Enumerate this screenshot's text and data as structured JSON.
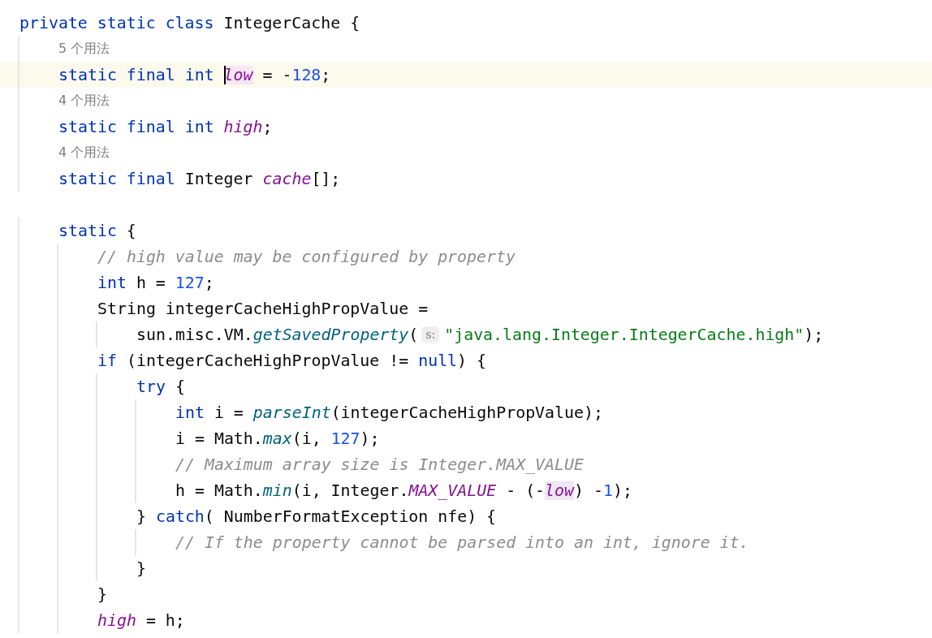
{
  "editor": {
    "lines": [
      {
        "kind": "code",
        "tokens": [
          {
            "kind": "keyword",
            "text": "private static class"
          },
          {
            "kind": "plain",
            "text": " IntegerCache {"
          }
        ],
        "children": [
          {
            "kind": "usages",
            "text": "5 个用法"
          },
          {
            "kind": "code",
            "current": true,
            "tokens": [
              {
                "kind": "keyword",
                "text": "static final int "
              },
              {
                "kind": "field",
                "text": "low",
                "caret": true,
                "color": "#f7e6f3"
              },
              {
                "kind": "plain",
                "text": " = -"
              },
              {
                "kind": "number",
                "text": "128"
              },
              {
                "kind": "plain",
                "text": ";"
              }
            ]
          },
          {
            "kind": "usages",
            "text": "4 个用法"
          },
          {
            "kind": "code",
            "tokens": [
              {
                "kind": "keyword",
                "text": "static final int "
              },
              {
                "kind": "field",
                "text": "high"
              },
              {
                "kind": "plain",
                "text": ";"
              }
            ]
          },
          {
            "kind": "usages",
            "text": "4 个用法"
          },
          {
            "kind": "code",
            "tokens": [
              {
                "kind": "keyword",
                "text": "static final"
              },
              {
                "kind": "plain",
                "text": " Integer "
              },
              {
                "kind": "field",
                "text": "cache"
              },
              {
                "kind": "plain",
                "text": "[];"
              }
            ]
          },
          {
            "kind": "blank"
          },
          {
            "kind": "code",
            "tokens": [
              {
                "kind": "keyword",
                "text": "static"
              },
              {
                "kind": "plain",
                "text": " {"
              }
            ],
            "children": [
              {
                "kind": "code",
                "tokens": [
                  {
                    "kind": "comment",
                    "text": "// high value may be configured by property"
                  }
                ]
              },
              {
                "kind": "code",
                "tokens": [
                  {
                    "kind": "keyword",
                    "text": "int"
                  },
                  {
                    "kind": "plain",
                    "text": " h = "
                  },
                  {
                    "kind": "number",
                    "text": "127"
                  },
                  {
                    "kind": "plain",
                    "text": ";"
                  }
                ]
              },
              {
                "kind": "code",
                "tokens": [
                  {
                    "kind": "plain",
                    "text": "String integerCacheHighPropValue ="
                  }
                ],
                "children": [
                  {
                    "kind": "code",
                    "tokens": [
                      {
                        "kind": "plain",
                        "text": "sun.misc.VM."
                      },
                      {
                        "kind": "method",
                        "text": "getSavedProperty"
                      },
                      {
                        "kind": "plain",
                        "text": "("
                      },
                      {
                        "kind": "hint",
                        "text": "s:"
                      },
                      {
                        "kind": "string",
                        "text": "\"java.lang.Integer.IntegerCache.high\""
                      },
                      {
                        "kind": "plain",
                        "text": ");"
                      }
                    ]
                  }
                ]
              },
              {
                "kind": "code",
                "tokens": [
                  {
                    "kind": "keyword",
                    "text": "if"
                  },
                  {
                    "kind": "plain",
                    "text": " (integerCacheHighPropValue != "
                  },
                  {
                    "kind": "keyword",
                    "text": "null"
                  },
                  {
                    "kind": "plain",
                    "text": ") {"
                  }
                ],
                "children": [
                  {
                    "kind": "code",
                    "tokens": [
                      {
                        "kind": "keyword",
                        "text": "try"
                      },
                      {
                        "kind": "plain",
                        "text": " {"
                      }
                    ],
                    "children": [
                      {
                        "kind": "code",
                        "tokens": [
                          {
                            "kind": "keyword",
                            "text": "int"
                          },
                          {
                            "kind": "plain",
                            "text": " i = "
                          },
                          {
                            "kind": "method",
                            "text": "parseInt"
                          },
                          {
                            "kind": "plain",
                            "text": "(integerCacheHighPropValue);"
                          }
                        ]
                      },
                      {
                        "kind": "code",
                        "tokens": [
                          {
                            "kind": "plain",
                            "text": "i = Math."
                          },
                          {
                            "kind": "method",
                            "text": "max"
                          },
                          {
                            "kind": "plain",
                            "text": "(i, "
                          },
                          {
                            "kind": "number",
                            "text": "127"
                          },
                          {
                            "kind": "plain",
                            "text": ");"
                          }
                        ]
                      },
                      {
                        "kind": "code",
                        "tokens": [
                          {
                            "kind": "comment",
                            "text": "// Maximum array size is Integer.MAX_VALUE"
                          }
                        ]
                      },
                      {
                        "kind": "code",
                        "tokens": [
                          {
                            "kind": "plain",
                            "text": "h = Math."
                          },
                          {
                            "kind": "method",
                            "text": "min"
                          },
                          {
                            "kind": "plain",
                            "text": "(i, Integer."
                          },
                          {
                            "kind": "field",
                            "text": "MAX_VALUE"
                          },
                          {
                            "kind": "plain",
                            "text": " - (-"
                          },
                          {
                            "kind": "field",
                            "text": "low",
                            "color": "#ede7f6"
                          },
                          {
                            "kind": "plain",
                            "text": ") -"
                          },
                          {
                            "kind": "number",
                            "text": "1"
                          },
                          {
                            "kind": "plain",
                            "text": ");"
                          }
                        ]
                      }
                    ]
                  },
                  {
                    "kind": "code",
                    "tokens": [
                      {
                        "kind": "plain",
                        "text": "} "
                      },
                      {
                        "kind": "keyword",
                        "text": "catch"
                      },
                      {
                        "kind": "plain",
                        "text": "( NumberFormatException nfe) {"
                      }
                    ],
                    "children": [
                      {
                        "kind": "code",
                        "tokens": [
                          {
                            "kind": "comment",
                            "text": "// If the property cannot be parsed into an int, ignore it."
                          }
                        ]
                      }
                    ]
                  },
                  {
                    "kind": "code",
                    "tokens": [
                      {
                        "kind": "plain",
                        "text": "}"
                      }
                    ]
                  }
                ]
              },
              {
                "kind": "code",
                "tokens": [
                  {
                    "kind": "plain",
                    "text": "}"
                  }
                ]
              },
              {
                "kind": "code",
                "tokens": [
                  {
                    "kind": "field",
                    "text": "high"
                  },
                  {
                    "kind": "plain",
                    "text": " = h;"
                  }
                ]
              }
            ]
          }
        ]
      }
    ]
  }
}
